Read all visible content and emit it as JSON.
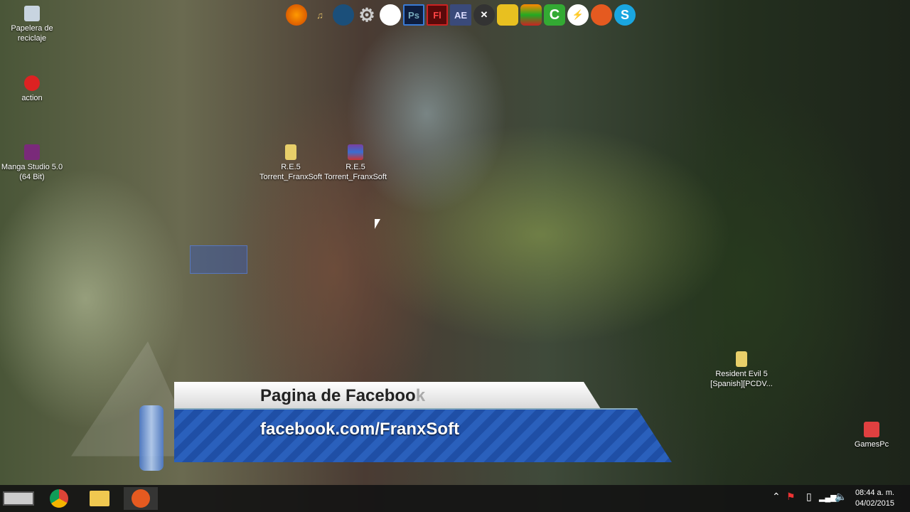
{
  "desktop_icons": [
    {
      "label": "Papelera de reciclaje",
      "icon": "recycle-bin-icon"
    },
    {
      "label": "action",
      "icon": "action-icon"
    },
    {
      "label": "Manga Studio 5.0 (64 Bit)",
      "icon": "manga-studio-icon"
    },
    {
      "label": "R.E.5 Torrent_FranxSoft",
      "icon": "folder-icon"
    },
    {
      "label": "R.E.5 Torrent_FranxSoft",
      "icon": "winrar-icon"
    },
    {
      "label": "Resident Evil 5 [Spanish][PCDV...",
      "icon": "folder-icon"
    },
    {
      "label": "GamesPc",
      "icon": "games-icon"
    }
  ],
  "dock": [
    {
      "name": "firefox",
      "text": ""
    },
    {
      "name": "music",
      "text": "♫"
    },
    {
      "name": "steam",
      "text": ""
    },
    {
      "name": "settings",
      "text": "⚙"
    },
    {
      "name": "unity",
      "text": ""
    },
    {
      "name": "photoshop",
      "text": "Ps"
    },
    {
      "name": "flash",
      "text": "Fl"
    },
    {
      "name": "after-effects",
      "text": "AE"
    },
    {
      "name": "xfire",
      "text": "✕"
    },
    {
      "name": "vmware",
      "text": ""
    },
    {
      "name": "winamp",
      "text": ""
    },
    {
      "name": "camtasia",
      "text": "C"
    },
    {
      "name": "flashget",
      "text": "⚡"
    },
    {
      "name": "origin",
      "text": ""
    },
    {
      "name": "skype",
      "text": "S"
    }
  ],
  "banner": {
    "title": "Pagina de Faceboo",
    "title_faded": "k",
    "url": "facebook.com/FranxSoft"
  },
  "taskbar": {
    "apps": [
      "nes-emulator",
      "chrome",
      "file-explorer",
      "origin"
    ],
    "time": "08:44 a. m.",
    "date": "04/02/2015"
  }
}
